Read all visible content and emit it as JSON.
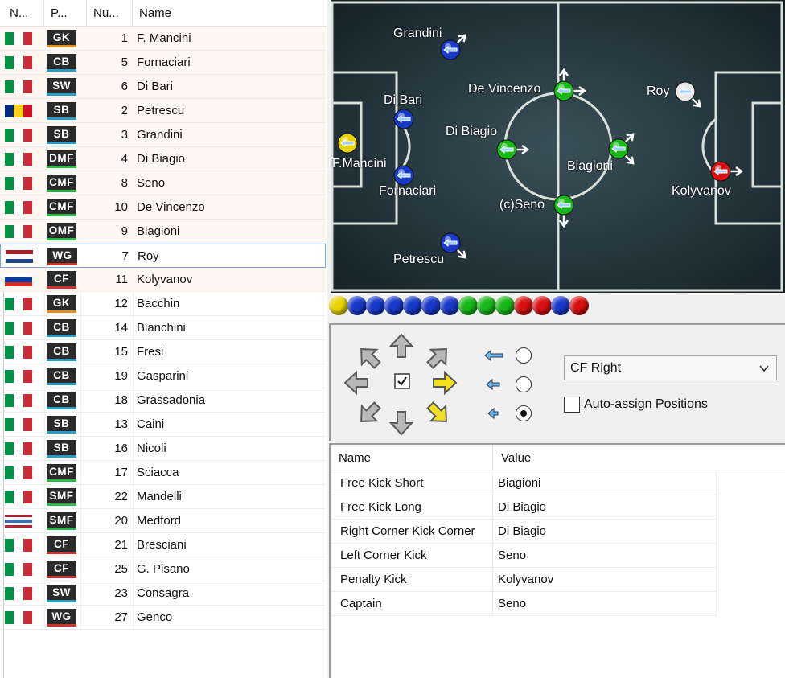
{
  "roster": {
    "columns": {
      "nationality": "N...",
      "position": "P...",
      "number": "Nu...",
      "name": "Name"
    },
    "players": [
      {
        "flag": "italy",
        "pos": "GK",
        "num": "1",
        "name": "F. Mancini",
        "starter": true
      },
      {
        "flag": "italy",
        "pos": "CB",
        "num": "5",
        "name": "Fornaciari",
        "starter": true
      },
      {
        "flag": "italy",
        "pos": "SW",
        "num": "6",
        "name": "Di Bari",
        "starter": true
      },
      {
        "flag": "romania",
        "pos": "SB",
        "num": "2",
        "name": "Petrescu",
        "starter": true
      },
      {
        "flag": "italy",
        "pos": "SB",
        "num": "3",
        "name": "Grandini",
        "starter": true
      },
      {
        "flag": "italy",
        "pos": "DMF",
        "num": "4",
        "name": "Di Biagio",
        "starter": true
      },
      {
        "flag": "italy",
        "pos": "CMF",
        "num": "8",
        "name": "Seno",
        "starter": true
      },
      {
        "flag": "italy",
        "pos": "CMF",
        "num": "10",
        "name": "De Vincenzo",
        "starter": true
      },
      {
        "flag": "italy",
        "pos": "OMF",
        "num": "9",
        "name": "Biagioni",
        "starter": true
      },
      {
        "flag": "netherlands",
        "pos": "WG",
        "num": "7",
        "name": "Roy",
        "starter": true,
        "selected": true
      },
      {
        "flag": "russia",
        "pos": "CF",
        "num": "11",
        "name": "Kolyvanov",
        "starter": true
      },
      {
        "flag": "italy",
        "pos": "GK",
        "num": "12",
        "name": "Bacchin"
      },
      {
        "flag": "italy",
        "pos": "CB",
        "num": "14",
        "name": "Bianchini"
      },
      {
        "flag": "italy",
        "pos": "CB",
        "num": "15",
        "name": "Fresi"
      },
      {
        "flag": "italy",
        "pos": "CB",
        "num": "19",
        "name": "Gasparini"
      },
      {
        "flag": "italy",
        "pos": "CB",
        "num": "18",
        "name": "Grassadonia"
      },
      {
        "flag": "italy",
        "pos": "SB",
        "num": "13",
        "name": "Caini"
      },
      {
        "flag": "italy",
        "pos": "SB",
        "num": "16",
        "name": "Nicoli"
      },
      {
        "flag": "italy",
        "pos": "CMF",
        "num": "17",
        "name": "Sciacca"
      },
      {
        "flag": "italy",
        "pos": "SMF",
        "num": "22",
        "name": "Mandelli"
      },
      {
        "flag": "usa",
        "pos": "SMF",
        "num": "20",
        "name": "Medford"
      },
      {
        "flag": "italy",
        "pos": "CF",
        "num": "21",
        "name": "Bresciani"
      },
      {
        "flag": "italy",
        "pos": "CF",
        "num": "25",
        "name": "G. Pisano"
      },
      {
        "flag": "italy",
        "pos": "SW",
        "num": "23",
        "name": "Consagra"
      },
      {
        "flag": "italy",
        "pos": "WG",
        "num": "27",
        "name": "Genco"
      }
    ]
  },
  "pitch": {
    "players": [
      {
        "label": "F.Mancini",
        "color": "yellow"
      },
      {
        "label": "Fornaciari",
        "color": "blue"
      },
      {
        "label": "Di Bari",
        "color": "blue"
      },
      {
        "label": "Petrescu",
        "color": "blue"
      },
      {
        "label": "Grandini",
        "color": "blue"
      },
      {
        "label": "Di Biagio",
        "color": "green"
      },
      {
        "label": "(c)Seno",
        "color": "green"
      },
      {
        "label": "De Vincenzo",
        "color": "green"
      },
      {
        "label": "Biagioni",
        "color": "green"
      },
      {
        "label": "Roy",
        "color": "white"
      },
      {
        "label": "Kolyvanov",
        "color": "red"
      }
    ]
  },
  "color_strip": [
    "yellow",
    "blue",
    "blue",
    "blue",
    "blue",
    "blue",
    "blue",
    "green",
    "green",
    "green",
    "red",
    "red",
    "blue",
    "red"
  ],
  "colors": {
    "yellow": "#e8d400",
    "blue": "#1838c8",
    "green": "#18b818",
    "red": "#d81010",
    "white": "#e8e8e8",
    "pitch": "#22343c",
    "pos_gk": "#e09020",
    "pos_def": "#2a9cc8",
    "pos_mid": "#2ab84a",
    "pos_fwd": "#d03030"
  },
  "controls": {
    "direction_icons": [
      "arrow-up-left-icon",
      "arrow-up-icon",
      "arrow-up-right-icon",
      "arrow-left-icon",
      "arrow-right-icon",
      "arrow-down-left-icon",
      "arrow-down-icon",
      "arrow-down-right-icon"
    ],
    "active_directions": [
      "right",
      "down-right"
    ],
    "center_checked": true,
    "arrow_length_options": [
      "long",
      "medium",
      "short"
    ],
    "arrow_length_selected": "short",
    "position_select": "CF Right",
    "auto_assign_label": "Auto-assign Positions",
    "auto_assign_checked": false
  },
  "properties": {
    "columns": {
      "name": "Name",
      "value": "Value"
    },
    "rows": [
      {
        "name": "Free Kick Short",
        "value": "Biagioni"
      },
      {
        "name": "Free Kick Long",
        "value": "Di Biagio"
      },
      {
        "name": "Right Corner Kick Corner",
        "value": "Di Biagio"
      },
      {
        "name": "Left Corner Kick",
        "value": "Seno"
      },
      {
        "name": "Penalty Kick",
        "value": "Kolyvanov"
      },
      {
        "name": "Captain",
        "value": "Seno"
      }
    ]
  }
}
